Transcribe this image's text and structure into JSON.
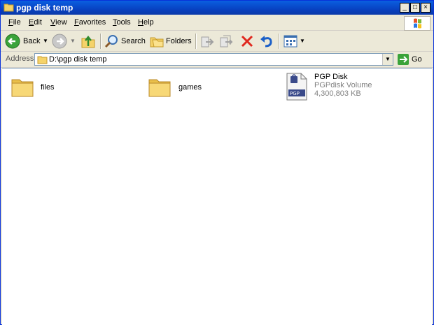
{
  "window": {
    "title": "pgp disk temp"
  },
  "title_buttons": {
    "minimize": "_",
    "maximize": "□",
    "close": "×"
  },
  "menu": [
    {
      "key": "F",
      "rest": "ile"
    },
    {
      "key": "E",
      "rest": "dit"
    },
    {
      "key": "V",
      "rest": "iew"
    },
    {
      "key": "F",
      "rest": "avorites",
      "prefix": ""
    },
    {
      "key": "T",
      "rest": "ools"
    },
    {
      "key": "H",
      "rest": "elp"
    }
  ],
  "toolbar": {
    "back": "Back",
    "search": "Search",
    "folders": "Folders"
  },
  "address": {
    "label": "Address",
    "value": "D:\\pgp disk temp",
    "go": "Go"
  },
  "items": [
    {
      "name": "files"
    },
    {
      "name": "games"
    },
    {
      "name": "PGP Disk",
      "type": "PGPdisk Volume",
      "size": "4,300,803 KB"
    }
  ],
  "colors": {
    "titlebar": "#0842c2",
    "selection_border": "#7f9db9",
    "folder": "#f5d36a"
  }
}
